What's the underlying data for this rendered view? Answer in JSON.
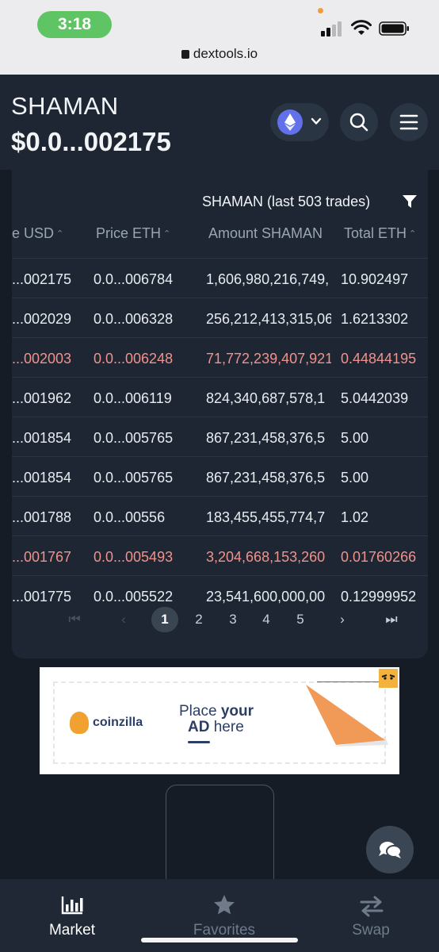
{
  "status_bar": {
    "time": "3:18",
    "url": "dextools.io"
  },
  "header": {
    "token_name": "SHAMAN",
    "price": "$0.0...002175"
  },
  "trades": {
    "title": "SHAMAN (last 503 trades)",
    "columns": [
      "e USD",
      "Price ETH",
      "Amount SHAMAN",
      "Total ETH"
    ],
    "rows": [
      {
        "usd": "...002175",
        "eth": "0.0...006784",
        "amount": "1,606,980,216,749,",
        "total": "10.902497",
        "type": "buy"
      },
      {
        "usd": "...002029",
        "eth": "0.0...006328",
        "amount": "256,212,413,315,06",
        "total": "1.6213302",
        "type": "buy"
      },
      {
        "usd": "...002003",
        "eth": "0.0...006248",
        "amount": "71,772,239,407,921",
        "total": "0.44844195",
        "type": "sell"
      },
      {
        "usd": "...001962",
        "eth": "0.0...006119",
        "amount": "824,340,687,578,1",
        "total": "5.0442039",
        "type": "buy"
      },
      {
        "usd": "...001854",
        "eth": "0.0...005765",
        "amount": "867,231,458,376,5",
        "total": "5.00",
        "type": "buy"
      },
      {
        "usd": "...001854",
        "eth": "0.0...005765",
        "amount": "867,231,458,376,5",
        "total": "5.00",
        "type": "buy"
      },
      {
        "usd": "...001788",
        "eth": "0.0...00556",
        "amount": "183,455,455,774,7",
        "total": "1.02",
        "type": "buy"
      },
      {
        "usd": "...001767",
        "eth": "0.0...005493",
        "amount": "3,204,668,153,260",
        "total": "0.01760266",
        "type": "sell"
      },
      {
        "usd": "...001775",
        "eth": "0.0...005522",
        "amount": "23,541,600,000,00",
        "total": "0.12999952",
        "type": "buy"
      }
    ],
    "pages": [
      "1",
      "2",
      "3",
      "4",
      "5"
    ],
    "active_page": "1"
  },
  "ad": {
    "brand": "coinzilla",
    "line1_a": "Place ",
    "line1_b": "your",
    "line2_a": "AD",
    "line2_b": " here"
  },
  "nav": [
    {
      "label": "Market",
      "icon": "chart-bars-icon",
      "active": true
    },
    {
      "label": "Favorites",
      "icon": "star-icon",
      "active": false
    },
    {
      "label": "Swap",
      "icon": "swap-arrows-icon",
      "active": false
    }
  ],
  "colors": {
    "buy": "#e8ecf1",
    "sell": "#f0928d",
    "eth": "#6270e9"
  }
}
